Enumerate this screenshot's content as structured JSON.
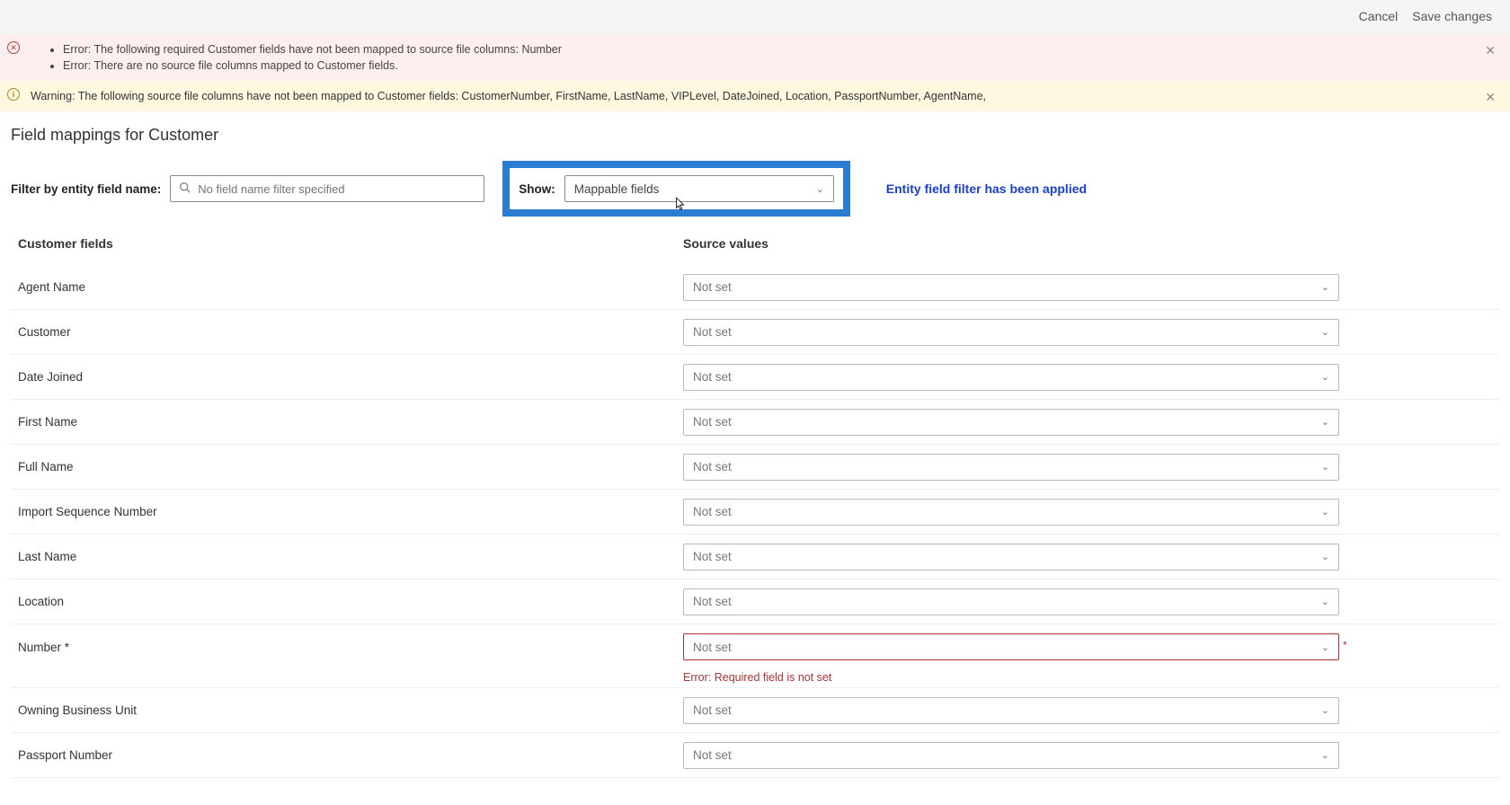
{
  "header": {
    "cancel": "Cancel",
    "save": "Save changes"
  },
  "banners": {
    "error1": "Error: The following required Customer fields have not been mapped to source file columns: Number",
    "error2": "Error: There are no source file columns mapped to Customer fields.",
    "warning": "Warning: The following source file columns have not been mapped to Customer fields: CustomerNumber, FirstName, LastName, VIPLevel, DateJoined, Location, PassportNumber, AgentName,"
  },
  "page": {
    "title": "Field mappings for Customer",
    "filter_label": "Filter by entity field name:",
    "filter_placeholder": "No field name filter specified",
    "show_label": "Show:",
    "show_value": "Mappable fields",
    "filter_applied": "Entity field filter has been applied",
    "col_left": "Customer fields",
    "col_right": "Source values",
    "not_set": "Not set",
    "required_error": "Error: Required field is not set"
  },
  "fields": {
    "agent_name": "Agent Name",
    "customer": "Customer",
    "date_joined": "Date Joined",
    "first_name": "First Name",
    "full_name": "Full Name",
    "import_seq": "Import Sequence Number",
    "last_name": "Last Name",
    "location": "Location",
    "number": "Number *",
    "owning_bu": "Owning Business Unit",
    "passport": "Passport Number"
  }
}
